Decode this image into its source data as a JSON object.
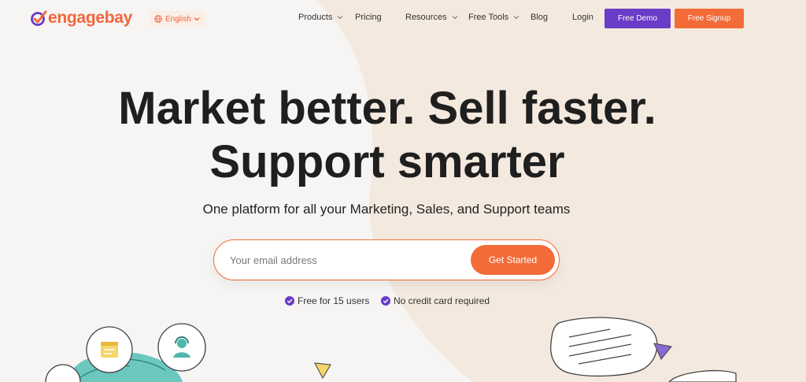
{
  "brand": {
    "logo_text": "engagebay"
  },
  "header": {
    "language": "English",
    "nav": [
      {
        "label": "Products",
        "has_dropdown": true
      },
      {
        "label": "Pricing",
        "has_dropdown": false
      },
      {
        "label": "Resources",
        "has_dropdown": true
      },
      {
        "label": "Free Tools",
        "has_dropdown": true
      },
      {
        "label": "Blog",
        "has_dropdown": false
      },
      {
        "label": "Login",
        "has_dropdown": false
      }
    ],
    "demo_button": "Free Demo",
    "signup_button": "Free Signup"
  },
  "hero": {
    "headline_line1": "Market better. Sell faster.",
    "headline_line2": "Support smarter",
    "subheadline": "One platform for all your Marketing, Sales, and Support teams",
    "email_placeholder": "Your email address",
    "cta_button": "Get Started",
    "perks": [
      "Free for 15 users",
      "No credit card required"
    ]
  },
  "colors": {
    "brand_orange": "#f26b38",
    "brand_purple": "#6a3cc8",
    "teal": "#6cc7be",
    "yellow": "#f6d66a"
  },
  "icons": {
    "language": "globe-icon",
    "perk": "check-circle-icon",
    "illustration_left_1": "calendar-card-icon",
    "illustration_left_2": "support-agent-icon",
    "illustration_right": "chat-bubble-icon"
  }
}
